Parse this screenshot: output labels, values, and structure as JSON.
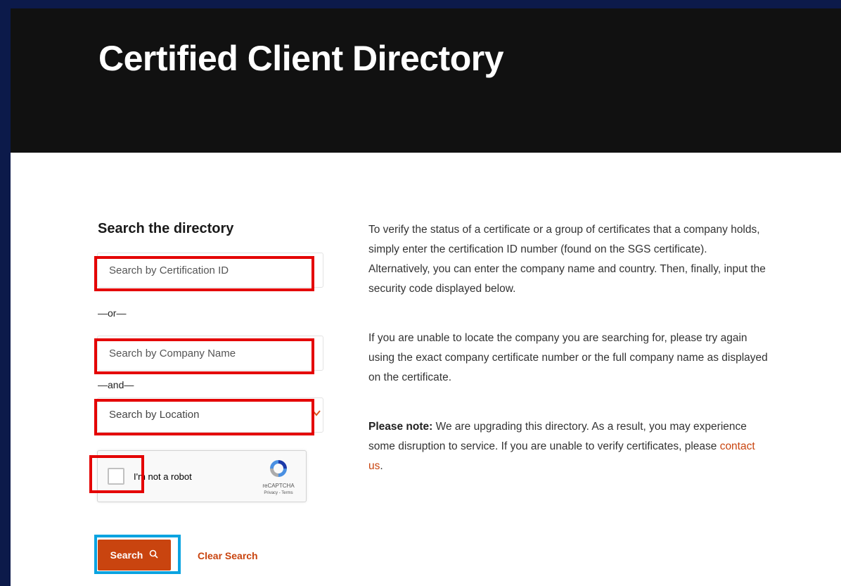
{
  "header": {
    "title": "Certified Client Directory"
  },
  "search": {
    "heading": "Search the directory",
    "cert_id_placeholder": "Search by Certification ID",
    "or_text": "—or—",
    "company_placeholder": "Search by Company Name",
    "and_text": "—and—",
    "location_placeholder": "Search by Location",
    "captcha": {
      "label": "I'm not a robot",
      "brand": "reCAPTCHA",
      "links": "Privacy - Terms"
    },
    "search_button": "Search",
    "clear_link": "Clear Search"
  },
  "info": {
    "paragraph1": "To verify the status of a certificate or a group of certificates that a company holds, simply enter the certification ID number (found on the SGS certificate). Alternatively, you can enter the company name and country. Then, finally, input the security code displayed below.",
    "paragraph2": "If you are unable to locate the company you are searching for, please try again using the exact company certificate number or the full company name as displayed on the certificate.",
    "note_label": "Please note:",
    "note_text": " We are upgrading this directory. As a result, you may experience some disruption to service. If you are unable to verify certificates, please ",
    "contact_link": "contact us",
    "note_end": "."
  },
  "colors": {
    "accent": "#c9440f",
    "header_bg": "#111111",
    "highlight_red": "#e40000",
    "highlight_blue": "#0aa3e0"
  }
}
